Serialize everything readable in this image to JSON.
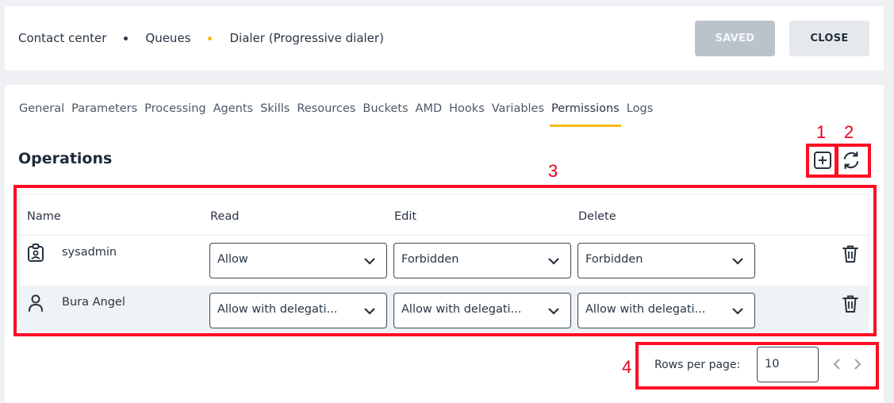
{
  "breadcrumb": {
    "items": [
      "Contact center",
      "Queues",
      "Dialer (Progressive dialer)"
    ],
    "dot_colors": [
      "#2d3b4d",
      "#f5bb0f"
    ]
  },
  "header_buttons": {
    "saved_label": "SAVED",
    "close_label": "CLOSE"
  },
  "tabs": [
    "General",
    "Parameters",
    "Processing",
    "Agents",
    "Skills",
    "Resources",
    "Buckets",
    "AMD",
    "Hooks",
    "Variables",
    "Permissions",
    "Logs"
  ],
  "active_tab": "Permissions",
  "section": {
    "title": "Operations",
    "add_icon": "plus-square-icon",
    "refresh_icon": "refresh-icon"
  },
  "table": {
    "columns": [
      "Name",
      "Read",
      "Edit",
      "Delete"
    ],
    "rows": [
      {
        "name": "sysadmin",
        "icon": "id-badge-icon",
        "read": "Allow",
        "edit": "Forbidden",
        "delete": "Forbidden"
      },
      {
        "name": "Bura Angel",
        "icon": "user-icon",
        "read": "Allow with delegati...",
        "edit": "Allow with delegati...",
        "delete": "Allow with delegati..."
      }
    ]
  },
  "pagination": {
    "rows_per_page_label": "Rows per page:",
    "rows_per_page_value": "10"
  },
  "annotations": [
    "1",
    "2",
    "3",
    "4"
  ],
  "colors": {
    "accent": "#f5bb0f",
    "annotation": "#ff0d24",
    "saved_button_bg": "#b9c3cc",
    "close_button_bg": "#e5e9ed"
  }
}
